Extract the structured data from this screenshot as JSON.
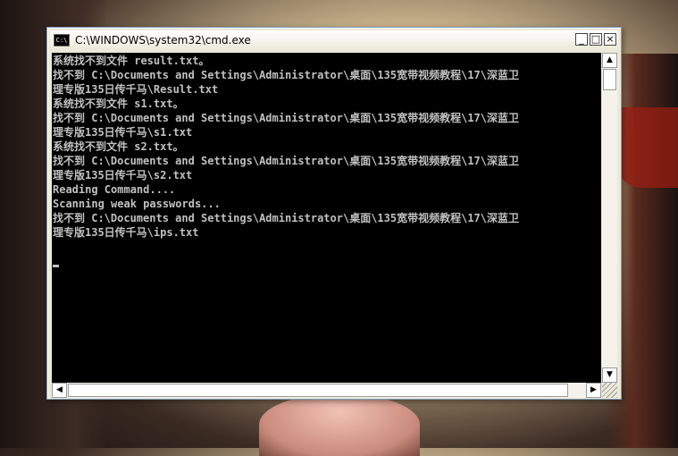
{
  "window": {
    "title": "C:\\WINDOWS\\system32\\cmd.exe",
    "icon_label": "C:\\",
    "buttons": {
      "minimize": "_",
      "maximize": "□",
      "close": "×"
    }
  },
  "console": {
    "lines": [
      "系统找不到文件 result.txt。",
      "找不到 C:\\Documents and Settings\\Administrator\\桌面\\135宽带视频教程\\17\\深蓝卫",
      "理专版135日传千马\\Result.txt",
      "系统找不到文件 s1.txt。",
      "找不到 C:\\Documents and Settings\\Administrator\\桌面\\135宽带视频教程\\17\\深蓝卫",
      "理专版135日传千马\\s1.txt",
      "系统找不到文件 s2.txt。",
      "找不到 C:\\Documents and Settings\\Administrator\\桌面\\135宽带视频教程\\17\\深蓝卫",
      "理专版135日传千马\\s2.txt",
      "Reading Command....",
      "Scanning weak passwords...",
      "找不到 C:\\Documents and Settings\\Administrator\\桌面\\135宽带视频教程\\17\\深蓝卫",
      "理专版135日传千马\\ips.txt",
      ""
    ]
  },
  "scrollbars": {
    "up_icon": "up-arrow-icon",
    "down_icon": "down-arrow-icon",
    "left_icon": "left-arrow-icon",
    "right_icon": "right-arrow-icon"
  }
}
